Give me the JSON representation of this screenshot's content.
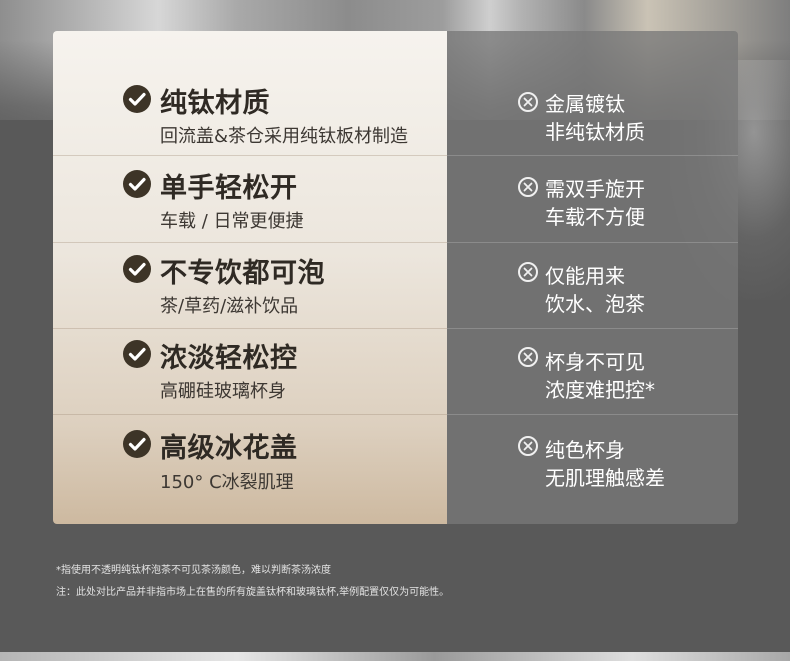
{
  "rows": [
    {
      "title": "纯钛材质",
      "subtitle": "回流盖&茶仓采用纯钛板材制造",
      "con_line1": "金属镀钛",
      "con_line2": "非纯钛材质"
    },
    {
      "title": "单手轻松开",
      "subtitle": "车载 / 日常更便捷",
      "con_line1": "需双手旋开",
      "con_line2": "车载不方便"
    },
    {
      "title": "不专饮都可泡",
      "subtitle": "茶/草药/滋补饮品",
      "con_line1": "仅能用来",
      "con_line2": "饮水、泡茶"
    },
    {
      "title": "浓淡轻松控",
      "subtitle": "高硼硅玻璃杯身",
      "con_line1": "杯身不可见",
      "con_line2": "浓度难把控*"
    },
    {
      "title": "高级冰花盖",
      "subtitle": "150° C冰裂肌理",
      "con_line1": "纯色杯身",
      "con_line2": "无肌理触感差"
    }
  ],
  "footnotes": {
    "note1": "*指使用不透明纯钛杯泡茶不可见茶汤颜色，难以判断茶汤浓度",
    "note2": "注：此处对比产品并非指市场上在售的所有旋盖钛杯和玻璃钛杯,举例配置仅仅为可能性。"
  },
  "icons": {
    "pro": "check-circle-icon",
    "con": "x-circle-icon"
  },
  "colors": {
    "check_bg": "#3d3427",
    "title_text": "#2f2a24",
    "con_text": "#ffffff"
  }
}
